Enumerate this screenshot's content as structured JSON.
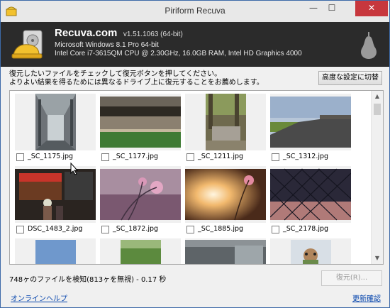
{
  "window": {
    "title": "Piriform Recuva",
    "minimize": "—",
    "maximize": "☐",
    "close": "✕"
  },
  "header": {
    "app_name": "Recuva",
    "app_suffix": ".com",
    "version": "v1.51.1063 (64-bit)",
    "os": "Microsoft Windows 8.1 Pro 64-bit",
    "hardware": "Intel Core i7-3615QM CPU @ 2.30GHz, 16.0GB RAM, Intel HD Graphics 4000"
  },
  "instructions": {
    "line1": "復元したいファイルをチェックして復元ボタンを押してください。",
    "line2": "よりよい結果を得るためには異なるドライブ上に復元することをお薦めします。"
  },
  "advanced_button": "高度な設定に切替",
  "files": [
    {
      "name": "_SC_1175.jpg",
      "checked": false
    },
    {
      "name": "_SC_1177.jpg",
      "checked": false
    },
    {
      "name": "_SC_1211.jpg",
      "checked": false
    },
    {
      "name": "_SC_1312.jpg",
      "checked": false
    },
    {
      "name": "DSC_1483_2.jpg",
      "checked": false
    },
    {
      "name": "_SC_1872.jpg",
      "checked": false
    },
    {
      "name": "_SC_1885.jpg",
      "checked": false
    },
    {
      "name": "_SC_2178.jpg",
      "checked": false
    }
  ],
  "status": "748ヶのファイルを検知(813ヶを無視) - 0.17 秒",
  "recover_button": "復元(R)...",
  "help_link": "オンラインヘルプ",
  "update_link": "更新確認",
  "colors": {
    "header_bg": "#2b2b2b",
    "close_btn": "#c7373d",
    "link": "#0645ad"
  }
}
